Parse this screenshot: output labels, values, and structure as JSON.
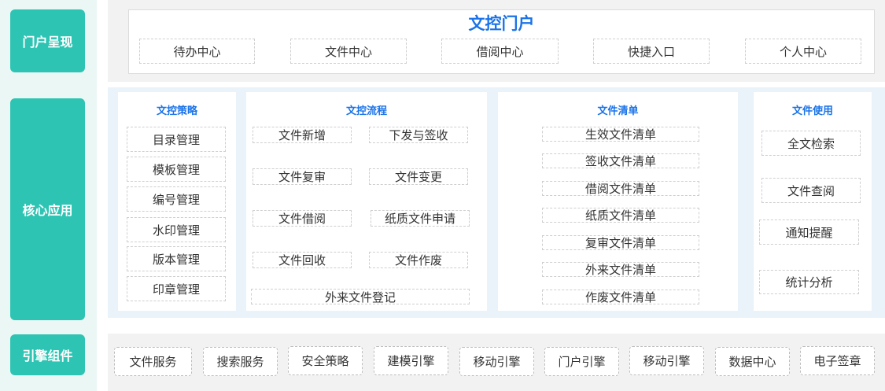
{
  "layers": {
    "portal": "门户呈现",
    "core": "核心应用",
    "engine": "引擎组件"
  },
  "portal": {
    "title": "文控门户",
    "items": [
      "待办中心",
      "文件中心",
      "借阅中心",
      "快捷入口",
      "个人中心"
    ]
  },
  "core": {
    "strategy": {
      "title": "文控策略",
      "items": [
        "目录管理",
        "模板管理",
        "编号管理",
        "水印管理",
        "版本管理",
        "印章管理"
      ]
    },
    "flow": {
      "title": "文控流程",
      "items": [
        "文件新增",
        "下发与签收",
        "文件复审",
        "文件变更",
        "文件借阅",
        "纸质文件申请",
        "文件回收",
        "文件作废",
        "外来文件登记"
      ]
    },
    "list": {
      "title": "文件清单",
      "items": [
        "生效文件清单",
        "签收文件清单",
        "借阅文件清单",
        "纸质文件清单",
        "复审文件清单",
        "外来文件清单",
        "作废文件清单"
      ]
    },
    "use": {
      "title": "文件使用",
      "items": [
        "全文检索",
        "文件查阅",
        "通知提醒",
        "统计分析"
      ]
    }
  },
  "engine": {
    "items": [
      "文件服务",
      "搜索服务",
      "安全策略",
      "建模引擎",
      "移动引擎",
      "门户引擎",
      "移动引擎",
      "数据中心",
      "电子签章"
    ]
  },
  "colors": {
    "teal": "#2ec4b3",
    "title_blue": "#1a73e8",
    "strip": "#eaf7f5",
    "band_gray": "#f2f2f3",
    "band_blue": "#eaf2fa"
  }
}
